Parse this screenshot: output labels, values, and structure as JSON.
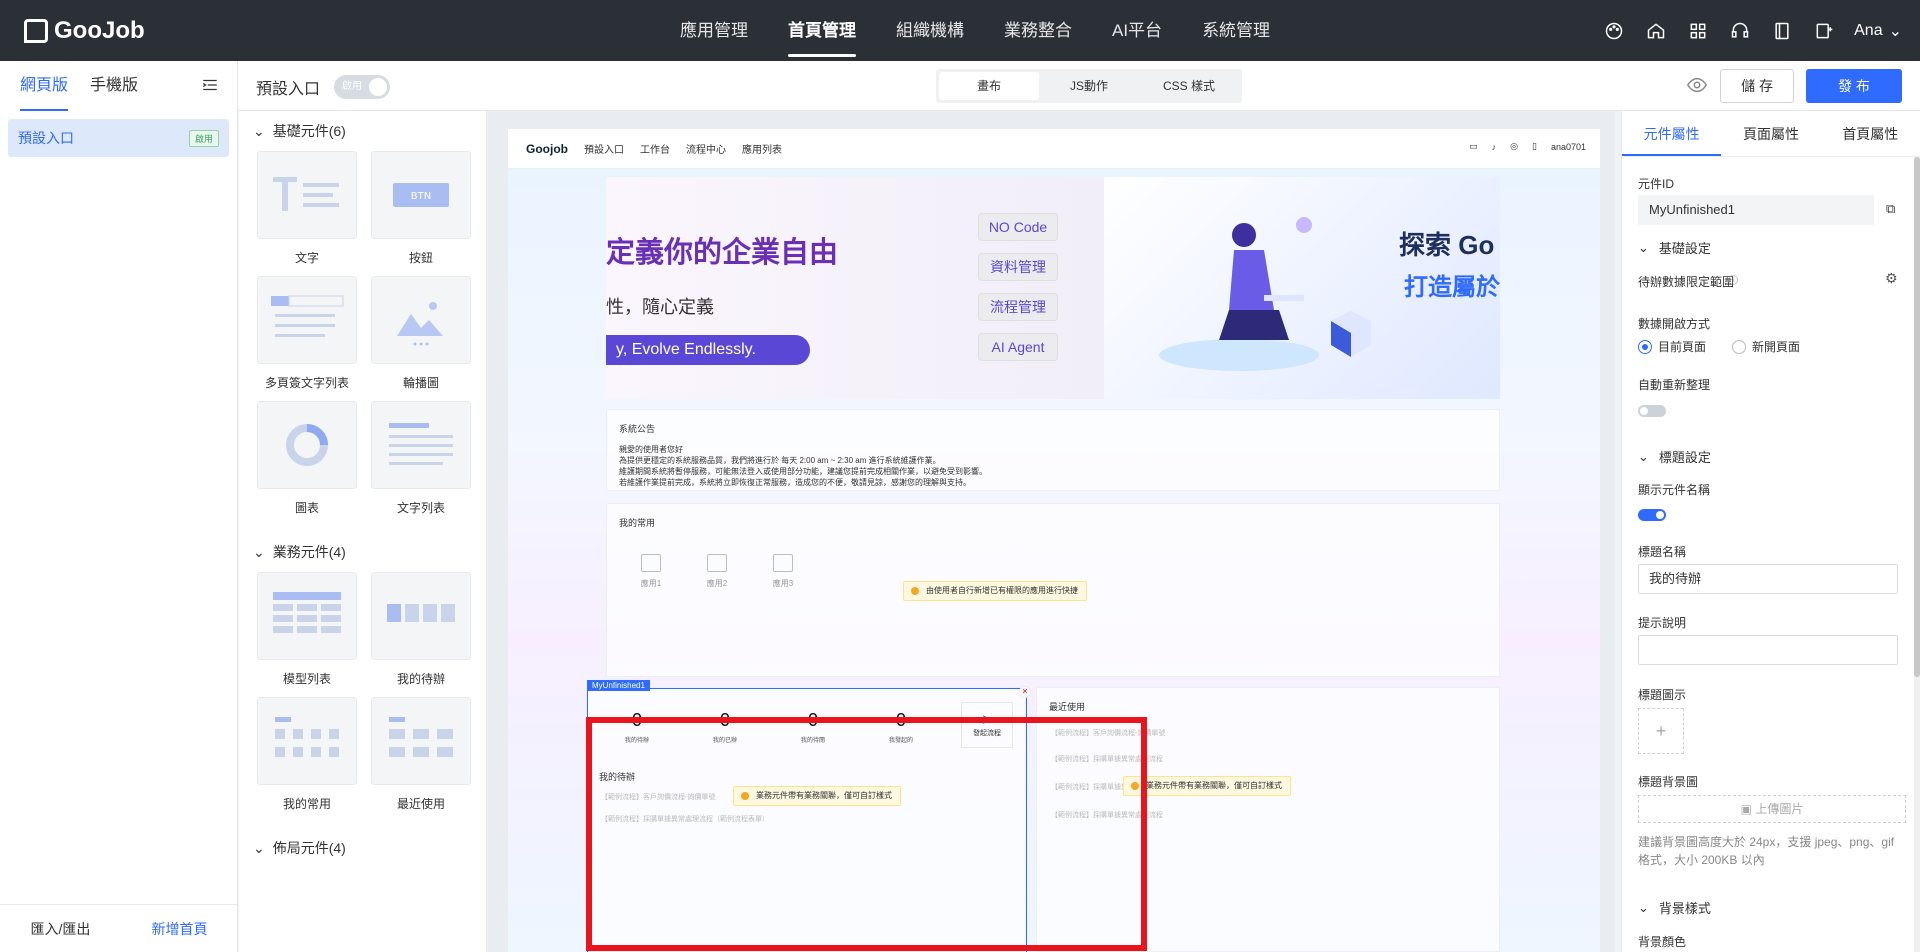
{
  "brand": {
    "name": "GooJob"
  },
  "nav": {
    "items": [
      "應用管理",
      "首頁管理",
      "組織機構",
      "業務整合",
      "AI平台",
      "系統管理"
    ],
    "active": "首頁管理"
  },
  "user": {
    "name": "Ana"
  },
  "left": {
    "tabs": [
      "網頁版",
      "手機版"
    ],
    "page_item": "預設入口",
    "page_badge": "啟用",
    "footer": {
      "import_export": "匯入/匯出",
      "add_home": "新增首頁"
    }
  },
  "toolbar": {
    "page_name": "預設入口",
    "toggle_label": "啟用",
    "modes": [
      "畫布",
      "JS動作",
      "CSS 樣式"
    ],
    "save": "儲 存",
    "publish": "發 布"
  },
  "components": {
    "basic": {
      "title": "基礎元件(6)",
      "items": [
        "文字",
        "按鈕",
        "多頁簽文字列表",
        "輪播圖",
        "圖表",
        "文字列表"
      ]
    },
    "business": {
      "title": "業務元件(4)",
      "items": [
        "模型列表",
        "我的待辦",
        "我的常用",
        "最近使用"
      ]
    },
    "layout": {
      "title": "佈局元件(4)"
    }
  },
  "preview": {
    "header": {
      "logo": "Goojob",
      "tabs": [
        "預設入口",
        "工作台",
        "流程中心",
        "應用列表"
      ],
      "user": "ana0701"
    },
    "banner": {
      "title": "定義你的企業自由",
      "subtitle": "性，隨心定義",
      "pill": "y, Evolve Endlessly.",
      "tags": [
        "NO Code",
        "資料管理",
        "流程管理",
        "AI Agent"
      ],
      "right_title": "探索 Go",
      "right_sub": "打造屬於"
    },
    "announcement": {
      "title": "系統公告",
      "lines": [
        "親愛的使用者您好",
        "為提供更穩定的系統服務品質，我們將進行於 每天 2:00 am ~ 2:30 am 進行系統維護作業。",
        "維護期間系統將暫停服務，可能無法登入或使用部分功能，建議您提前完成相關作業，以避免受到影響。",
        "若維護作業提前完成，系統將立即恢復正常服務，造成您的不便，敬請見諒，感謝您的理解與支持。"
      ]
    },
    "favorites": {
      "title": "我的常用",
      "items": [
        "應用1",
        "應用2",
        "應用3"
      ],
      "hint": "由使用者自行新增已有權限的應用進行快捷"
    },
    "todo": {
      "tag": "MyUnfinished1",
      "stats": [
        {
          "num": "0",
          "label": "我的待辦"
        },
        {
          "num": "0",
          "label": "我的已辦"
        },
        {
          "num": "0",
          "label": "我的待閱"
        },
        {
          "num": "0",
          "label": "我發起的"
        }
      ],
      "launch": "發起流程",
      "list_title": "我的待辦",
      "hint": "業務元件帶有業務關聯，僅可自訂樣式",
      "rows": [
        "【範例流程】客戶詢價流程-詢價單號",
        "【範例流程】採購單據異常處理流程（範例流程表單）"
      ]
    },
    "recent": {
      "title": "最近使用",
      "hint": "業務元件帶有業務關聯，僅可自訂樣式",
      "rows": [
        "【範例流程】客戶詢價流程-詢價單號",
        "【範例流程】採購單據異常處理流程",
        "【範例流程】採購單據異常處理",
        "【範例流程】採購單據異常處理流程"
      ]
    }
  },
  "props": {
    "tabs": [
      "元件屬性",
      "頁面屬性",
      "首頁屬性"
    ],
    "id_label": "元件ID",
    "id_value": "MyUnfinished1",
    "basic_section": "基礎設定",
    "range_label": "待辦數據限定範圍",
    "open_label": "數據開啟方式",
    "open_options": [
      "目前頁面",
      "新開頁面"
    ],
    "auto_refresh": "自動重新整理",
    "title_section": "標題設定",
    "show_name": "顯示元件名稱",
    "title_name_label": "標題名稱",
    "title_name_value": "我的待辦",
    "tooltip_label": "提示說明",
    "title_icon_label": "標題圖示",
    "bg_image_label": "標題背景圖",
    "upload_label": "上傳圖片",
    "upload_help": "建議背景圖高度大於 24px，支援 jpeg、png、gif 格式，大小 200KB 以內",
    "bg_style_section": "背景樣式",
    "bg_color_label": "背景顏色"
  },
  "colors": {
    "accent": "#2f6bff",
    "topbar": "#2b3037",
    "highlight": "#e8161c"
  }
}
